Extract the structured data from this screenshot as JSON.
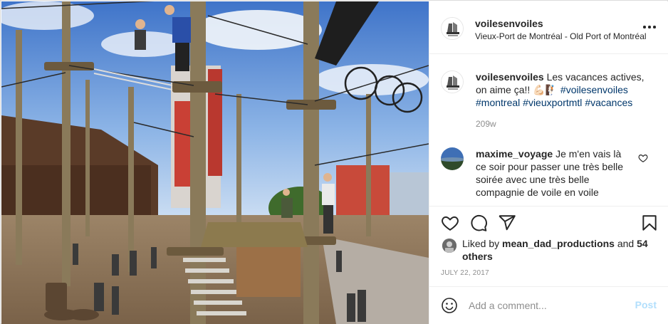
{
  "post": {
    "username": "voilesenvoiles",
    "location": "Vieux-Port de Montréal - Old Port of Montréal",
    "caption": {
      "username": "voilesenvoiles",
      "text": "Les vacances actives, on aime ça!! 💪🏻🧗🏻",
      "hashtags": [
        "#voilesenvoiles",
        "#montreal",
        "#vieuxportmtl",
        "#vacances"
      ],
      "time": "209w"
    },
    "comments": [
      {
        "username": "maxime_voyage",
        "text": "Je m'en vais là ce soir pour passer une très belle soirée avec une très belle compagnie de voile en voile"
      }
    ],
    "likes": {
      "prefix": "Liked by",
      "username": "mean_dad_productions",
      "and": "and",
      "others": "54 others"
    },
    "date": "July 22, 2017",
    "add_comment": {
      "placeholder": "Add a comment...",
      "post_label": "Post"
    }
  },
  "icons": {
    "more": "more-options-icon",
    "like": "heart-icon",
    "comment": "comment-icon",
    "share": "share-icon",
    "save": "bookmark-icon",
    "emoji": "emoji-icon"
  },
  "colors": {
    "text": "#262626",
    "secondary": "#8e8e8e",
    "link": "#00376b",
    "post_button_disabled": "#b2dffc",
    "border": "#dbdbdb"
  }
}
